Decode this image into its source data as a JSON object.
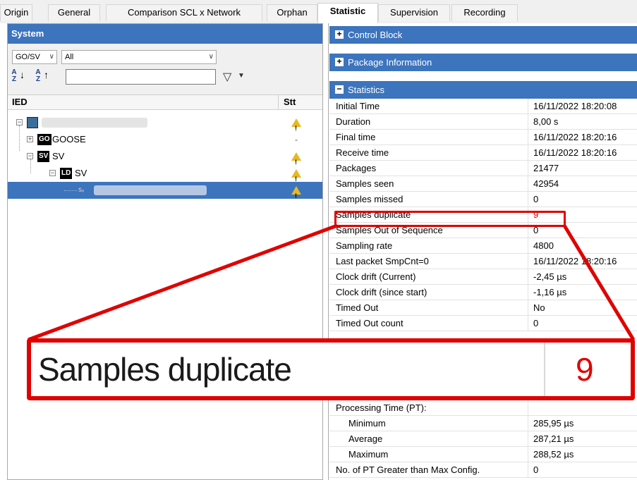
{
  "tabs": [
    {
      "label": "Origin",
      "active": false
    },
    {
      "label": "General",
      "active": false
    },
    {
      "label": "Comparison SCL x Network",
      "active": false
    },
    {
      "label": "Orphan",
      "active": false
    },
    {
      "label": "Statistic",
      "active": true
    },
    {
      "label": "Supervision",
      "active": false
    },
    {
      "label": "Recording",
      "active": false
    }
  ],
  "system": {
    "title": "System",
    "type_combo": "GO/SV",
    "filter_combo": "All",
    "sort_az": "A Z",
    "sort_za": "A Z",
    "filter_value": "",
    "columns": {
      "ied": "IED",
      "stt": "Stt"
    },
    "tree": [
      {
        "label": "",
        "badge": "",
        "status": "warning"
      },
      {
        "label": "GOOSE",
        "badge": "GO",
        "status": "-"
      },
      {
        "label": "SV",
        "badge": "SV",
        "status": "warning"
      },
      {
        "label": "SV",
        "badge": "LD",
        "status": "warning"
      },
      {
        "label": "",
        "badge": "",
        "status": "warning",
        "selected": true
      }
    ]
  },
  "sections": {
    "control_block": "Control Block",
    "package_info": "Package Information",
    "statistics": "Statistics"
  },
  "statistics": [
    {
      "label": "Initial Time",
      "value": "16/11/2022 18:20:08"
    },
    {
      "label": "Duration",
      "value": "8,00 s"
    },
    {
      "label": "Final time",
      "value": "16/11/2022 18:20:16"
    },
    {
      "label": "Receive time",
      "value": "16/11/2022 18:20:16"
    },
    {
      "label": "Packages",
      "value": "21477"
    },
    {
      "label": "Samples seen",
      "value": "42954"
    },
    {
      "label": "Samples missed",
      "value": "0"
    },
    {
      "label": "Samples duplicate",
      "value": "9",
      "highlight": true
    },
    {
      "label": "Samples Out of Sequence",
      "value": "0"
    },
    {
      "label": "Sampling rate",
      "value": "4800"
    },
    {
      "label": "Last packet SmpCnt=0",
      "value": "16/11/2022 18:20:16"
    },
    {
      "label": "Clock drift (Current)",
      "value": "-2,45 µs"
    },
    {
      "label": "Clock drift (since start)",
      "value": "-1,16 µs"
    },
    {
      "label": "Timed Out",
      "value": "No"
    },
    {
      "label": "Timed Out count",
      "value": "0"
    }
  ],
  "processing": [
    {
      "label": "Processing Time (PT):",
      "value": ""
    },
    {
      "label": "Minimum",
      "value": "285,95 µs"
    },
    {
      "label": "Average",
      "value": "287,21 µs"
    },
    {
      "label": "Maximum",
      "value": "288,52 µs"
    },
    {
      "label": "No. of PT Greater than Max Config.",
      "value": "0"
    }
  ],
  "zoom": {
    "label": "Samples duplicate",
    "value": "9"
  },
  "colors": {
    "accent": "#3c74bd",
    "highlight": "#e00000",
    "warning": "#e8b820"
  }
}
